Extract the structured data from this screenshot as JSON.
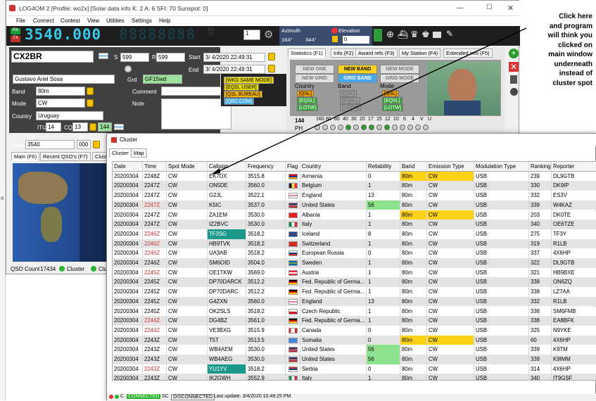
{
  "main": {
    "title": "LOG4OM 2 [Profile: wo2x] [Solar data info K: 2 A: 6 SFI: 70 Sunspot: 0]",
    "menu": [
      "File",
      "Connect",
      "Contest",
      "View",
      "Utilities",
      "Settings",
      "Help"
    ],
    "rx_tx": [
      "RX",
      "TX"
    ],
    "frequency_display": "3540.000",
    "spin_value": "1",
    "azimuth_label": "Azimuth",
    "azimuth_values": [
      "164°",
      "344°"
    ],
    "elevation_label": "Elevation",
    "elevation_value": "0",
    "callsign": "CX2BR",
    "s_label": "S",
    "s_value": "599",
    "r_label": "R",
    "r_value": "599",
    "start_label": "Start",
    "start_value": "3/ 4/2020 22:49:31",
    "end_label": "End",
    "end_value": "3/ 4/2020 22:49:31",
    "name": "Gustavo Ariel Sosa",
    "grid_label": "Grd",
    "grid_value": "GF15wd",
    "band_label": "Band",
    "band_value": "80m",
    "mode_label": "Mode",
    "mode_value": "CW",
    "country_label": "Country",
    "country_value": "Uruguay",
    "comment_label": "Comment",
    "note_label": "Note",
    "itu_label": "ITU",
    "itu_value": "14",
    "cq_label": "CQ",
    "cq_value": "13",
    "cq_extra": "144",
    "freq_label": "Freq",
    "khz_label": "KHz",
    "hz_label": "Hz",
    "freq_value": "3540",
    "hz_value": "000",
    "wkd_tags": [
      "[WKD SAME MODE]",
      "[EQSL USER]",
      "[QSL BUREAU]",
      "[QRZ.COM]"
    ],
    "tabs": [
      "Statistics (F1)",
      "Info (F2)",
      "Award refs (F3)",
      "My Station (F4)",
      "Extended info (F5)"
    ],
    "stat_buttons": [
      "NEW ONE",
      "NEW BAND",
      "NEW MODE",
      "NEW GRID",
      "GRID BAND",
      "GRID MODE"
    ],
    "stat_cols": [
      "Country",
      "Band",
      "Mode"
    ],
    "stat_qsl": [
      "[QSL]",
      "[EQSL]",
      "[LOTW]"
    ],
    "band_scale_label": "144",
    "band_scale": [
      "160",
      "80",
      "60",
      "40",
      "30",
      "20",
      "17",
      "15",
      "12",
      "10",
      "6",
      "4",
      "V",
      "U"
    ],
    "ph_label": "PH",
    "left_tabs": [
      "Main (F6)",
      "Recent QSO's (F7)",
      "Clust"
    ],
    "qso_count_label": "QSO Count",
    "qso_count": "17434",
    "cluster_status_label": "Cluster",
    "cluster_status_label2": "Clu"
  },
  "annotation": [
    "Click here",
    "and program",
    "will think you",
    "clicked on",
    "main window",
    "underneath",
    "instead of",
    "cluster spot"
  ],
  "cluster": {
    "title": "Cluster",
    "tabs": [
      "Cluster",
      "Map"
    ],
    "columns": [
      "Date",
      "Time",
      "Spot Mode",
      "Callsign",
      "Frequency",
      "Flag",
      "Country",
      "Reliability",
      "Band",
      "Emission Type",
      "Modulation Type",
      "Ranking",
      "Reporter"
    ],
    "rows": [
      [
        "20200304",
        "2248Z",
        "CW",
        "EK7DX",
        "3515.8",
        "",
        "Armenia",
        "0",
        "80m",
        "CW",
        "USB",
        "239",
        "DL9GTB"
      ],
      [
        "20200304",
        "2247Z",
        "CW",
        "ON5DE",
        "3560.0",
        "",
        "Belgium",
        "1",
        "80m",
        "CW",
        "USB",
        "330",
        "DK9IP"
      ],
      [
        "20200304",
        "2247Z",
        "CW",
        "G2JL",
        "3522.1",
        "",
        "England",
        "13",
        "80m",
        "CW",
        "USB",
        "332",
        "ES3V"
      ],
      [
        "20200304",
        "2247Z",
        "CW",
        "K5IC",
        "3537.0",
        "",
        "United States",
        "56",
        "80m",
        "CW",
        "USB",
        "339",
        "W4KAZ"
      ],
      [
        "20200304",
        "2247Z",
        "CW",
        "ZA1EM",
        "3530.0",
        "",
        "Albania",
        "1",
        "80m",
        "CW",
        "USB",
        "203",
        "DK0TE"
      ],
      [
        "20200304",
        "2247Z",
        "CW",
        "IZ2BVC",
        "3530.0",
        "",
        "Italy",
        "1",
        "80m",
        "CW",
        "USB",
        "340",
        "OE6TZE"
      ],
      [
        "20200304",
        "2246Z",
        "CW",
        "TF3SG",
        "3518.2",
        "",
        "Iceland",
        "8",
        "80m",
        "CW",
        "USB",
        "275",
        "TF3Y"
      ],
      [
        "20200304",
        "2246Z",
        "CW",
        "HB9TVK",
        "3518.2",
        "",
        "Switzerland",
        "1",
        "80m",
        "CW",
        "USB",
        "319",
        "R1LB"
      ],
      [
        "20200304",
        "2246Z",
        "CW",
        "UA3AB",
        "3518.2",
        "",
        "European Russia",
        "0",
        "80m",
        "CW",
        "USB",
        "337",
        "4X6HP"
      ],
      [
        "20200304",
        "2246Z",
        "CW",
        "SM6OID",
        "3504.0",
        "",
        "Sweden",
        "1",
        "80m",
        "CW",
        "USB",
        "322",
        "DL9GTB"
      ],
      [
        "20200304",
        "2245Z",
        "CW",
        "OE1TKW",
        "3569.0",
        "",
        "Austria",
        "1",
        "80m",
        "CW",
        "USB",
        "321",
        "HB9BXE"
      ],
      [
        "20200304",
        "2245Z",
        "CW",
        "DP70DARCK",
        "3512.2",
        "",
        "Fed. Republic of Germa...",
        "1",
        "80m",
        "CW",
        "USB",
        "338",
        "ON6ZQ"
      ],
      [
        "20200304",
        "2245Z",
        "CW",
        "DP70DARC",
        "3512.2",
        "",
        "Fed. Republic of Germa...",
        "1",
        "80m",
        "CW",
        "USB",
        "338",
        "LZ7AA"
      ],
      [
        "20200304",
        "2245Z",
        "CW",
        "G4ZXN",
        "3560.0",
        "",
        "England",
        "13",
        "80m",
        "CW",
        "USB",
        "332",
        "R1LB"
      ],
      [
        "20200304",
        "2245Z",
        "CW",
        "OK2SLS",
        "3518.2",
        "",
        "Czech Republic",
        "1",
        "80m",
        "CW",
        "USB",
        "338",
        "SM6FMB"
      ],
      [
        "20200304",
        "2244Z",
        "CW",
        "DG4BZ",
        "3561.0",
        "",
        "Fed. Republic of Germa...",
        "1",
        "80m",
        "CW",
        "USB",
        "338",
        "EA8BFK"
      ],
      [
        "20200304",
        "2244Z",
        "CW",
        "VE3BXG",
        "3515.9",
        "",
        "Canada",
        "0",
        "80m",
        "CW",
        "USB",
        "325",
        "N9YKE"
      ],
      [
        "20200304",
        "2243Z",
        "CW",
        "T5T",
        "3513.5",
        "",
        "Somalia",
        "0",
        "80m",
        "CW",
        "USB",
        "60",
        "4X6HP"
      ],
      [
        "20200304",
        "2243Z",
        "CW",
        "WB4AEM",
        "3530.0",
        "",
        "United States",
        "56",
        "80m",
        "CW",
        "USB",
        "339",
        "K9TM"
      ],
      [
        "20200304",
        "2243Z",
        "CW",
        "WB4AEG",
        "3530.0",
        "",
        "United States",
        "56",
        "80m",
        "CW",
        "USB",
        "339",
        "K9IMM"
      ],
      [
        "20200304",
        "2243Z",
        "CW",
        "YU1YV",
        "3518.2",
        "",
        "Serbia",
        "0",
        "80m",
        "CW",
        "USB",
        "314",
        "4X6HP"
      ],
      [
        "20200304",
        "2243Z",
        "CW",
        "IK2GWH",
        "3552.9",
        "",
        "Italy",
        "1",
        "80m",
        "CW",
        "USB",
        "340",
        "IT9GSF"
      ]
    ],
    "status_connected": "CONNECTED",
    "status_sc": "SC",
    "status_disconnected": "DISCONNECTED",
    "last_update": "Last update: 3/4/2020 10:49:25 PM",
    "status_c": "C"
  },
  "colors": {
    "red_time": "#d03030",
    "yellow": "#ffd21a",
    "green": "#8de28d",
    "teal": "#1b9a8c",
    "freq_cyan": "#38c8e8"
  }
}
